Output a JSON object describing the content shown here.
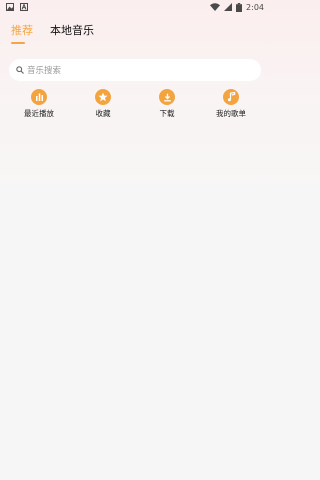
{
  "status_bar": {
    "time": "2:04",
    "left_icons": [
      "image-icon",
      "a-notification-icon"
    ],
    "right_icons": [
      "wifi-icon",
      "signal-icon",
      "battery-icon"
    ]
  },
  "tabs": [
    {
      "label": "推荐",
      "active": true
    },
    {
      "label": "本地音乐",
      "active": false
    }
  ],
  "search": {
    "placeholder": "音乐搜索",
    "icon": "search-icon"
  },
  "quick_actions": [
    {
      "label": "最近播放",
      "icon": "bar-chart-icon"
    },
    {
      "label": "收藏",
      "icon": "star-icon"
    },
    {
      "label": "下载",
      "icon": "download-icon"
    },
    {
      "label": "我的歌单",
      "icon": "music-note-icon"
    }
  ],
  "colors": {
    "accent": "#f5a545",
    "icon_bg": "#f3a43f",
    "tab_inactive": "#111111",
    "placeholder": "#999999"
  }
}
